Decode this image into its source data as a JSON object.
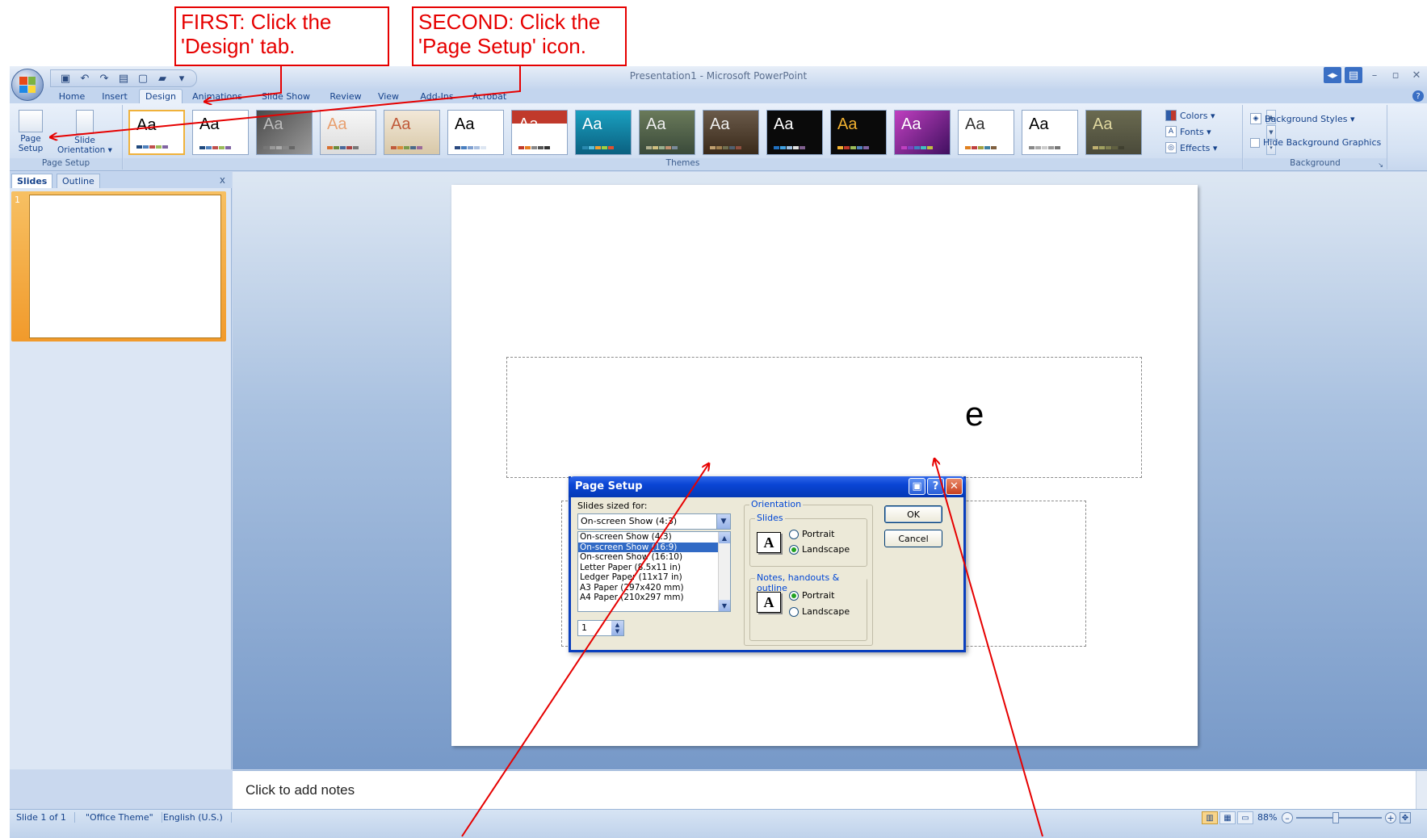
{
  "annotations": {
    "first_text": "FIRST: Click the\n'Design' tab.",
    "second_text": "SECOND: Click the\n'Page Setup' icon."
  },
  "window": {
    "title": "Presentation1 - Microsoft PowerPoint"
  },
  "ribbon": {
    "tabs": [
      "Home",
      "Insert",
      "Design",
      "Animations",
      "Slide Show",
      "Review",
      "View",
      "Add-Ins",
      "Acrobat"
    ],
    "active_tab": "Design",
    "page_setup_group": {
      "label": "Page Setup",
      "page_setup_label": "Page\nSetup",
      "slide_orientation_label": "Slide\nOrientation ▾"
    },
    "themes_group": {
      "label": "Themes",
      "thumb_text": "Aa",
      "colors": "Colors ▾",
      "fonts": "Fonts ▾",
      "effects": "Effects ▾"
    },
    "background_group": {
      "label": "Background",
      "background_styles": "Background Styles ▾",
      "hide_graphics": "Hide Background Graphics"
    }
  },
  "slides_pane": {
    "tabs": [
      "Slides",
      "Outline"
    ],
    "close": "x",
    "slide_number": "1"
  },
  "slide": {
    "title_fragment": "e"
  },
  "notes": {
    "placeholder": "Click to add notes"
  },
  "statusbar": {
    "slide_info": "Slide 1 of 1",
    "theme": "\"Office Theme\"",
    "language": "English (U.S.)",
    "zoom": "88%"
  },
  "dialog": {
    "title": "Page Setup",
    "slides_sized_for_label": "Slides sized for:",
    "selected_size": "On-screen Show (4:3)",
    "size_options": [
      "On-screen Show (4:3)",
      "On-screen Show (16:9)",
      "On-screen Show (16:10)",
      "Letter Paper (8.5x11 in)",
      "Ledger Paper (11x17 in)",
      "A3 Paper (297x420 mm)",
      "A4 Paper (210x297 mm)"
    ],
    "highlighted_option_index": 1,
    "number_value": "1",
    "orientation_label": "Orientation",
    "slides_label": "Slides",
    "notes_label": "Notes, handouts & outline",
    "portrait": "Portrait",
    "landscape": "Landscape",
    "ok": "OK",
    "cancel": "Cancel",
    "orient_icon_letter": "A"
  },
  "colors": {
    "annotation": "#e60000",
    "ribbon_text": "#15428b",
    "dialog_title": "#0a45d4"
  }
}
